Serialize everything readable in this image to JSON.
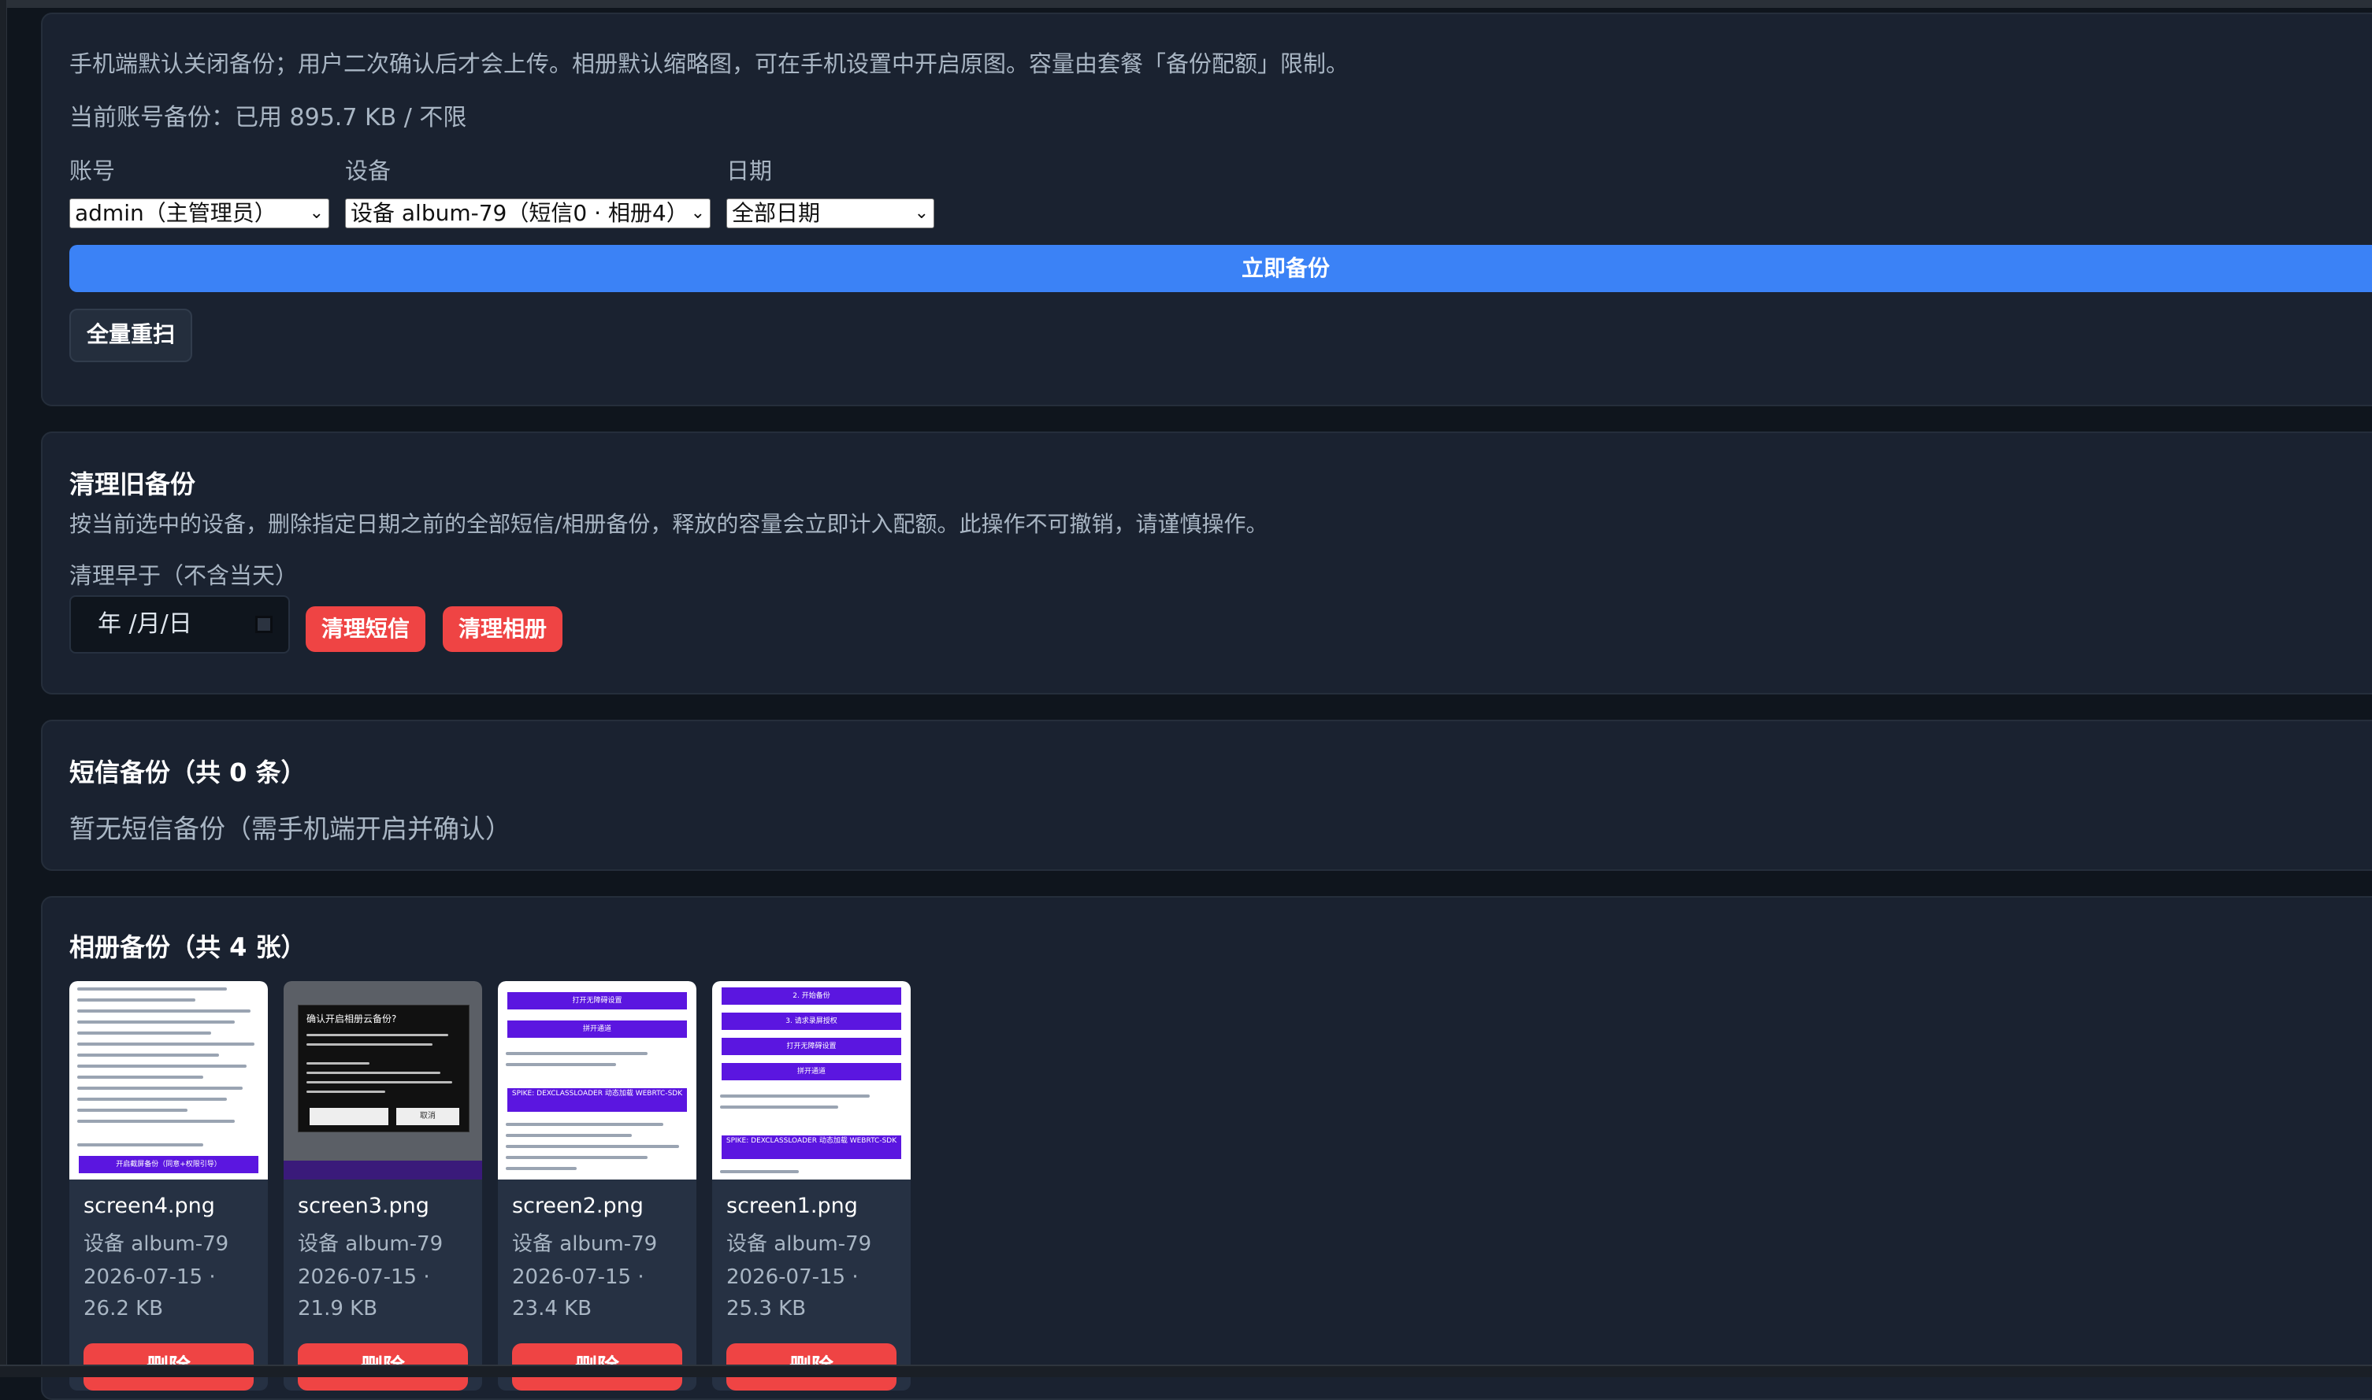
{
  "backup_settings": {
    "notice": "手机端默认关闭备份；用户二次确认后才会上传。相册默认缩略图，可在手机设置中开启原图。容量由套餐「备份配额」限制。",
    "usage": "当前账号备份：已用 895.7 KB / 不限",
    "account_label": "账号",
    "account_value": "admin（主管理员）",
    "device_label": "设备",
    "device_value": "设备 album-79（短信0 · 相册4）",
    "date_label": "日期",
    "date_value": "全部日期",
    "backup_now": "立即备份",
    "full_rescan": "全量重扫"
  },
  "cleanup": {
    "title": "清理旧备份",
    "description": "按当前选中的设备，删除指定日期之前的全部短信/相册备份，释放的容量会立即计入配额。此操作不可撤销，请谨慎操作。",
    "before_label": "清理早于（不含当天）",
    "date_placeholder": "年 /月/日",
    "clear_sms": "清理短信",
    "clear_album": "清理相册"
  },
  "sms": {
    "title": "短信备份（共 0 条）",
    "empty": "暂无短信备份（需手机端开启并确认）"
  },
  "album": {
    "title": "相册备份（共 4 张）",
    "items": [
      {
        "name": "screen4.png",
        "device": "设备 album-79",
        "info": "2026-07-15 · 26.2 KB",
        "delete": "删除",
        "thumb_caption": "开启截屏备份（同意+权限引导）"
      },
      {
        "name": "screen3.png",
        "device": "设备 album-79",
        "info": "2026-07-15 · 21.9 KB",
        "delete": "删除",
        "thumb_dialog_title": "确认开启相册云备份?",
        "thumb_cancel": "取消"
      },
      {
        "name": "screen2.png",
        "device": "设备 album-79",
        "info": "2026-07-15 · 23.4 KB",
        "delete": "删除",
        "thumb_btn1": "打开无障碍设置",
        "thumb_btn2": "拼开通道",
        "thumb_spike": "SPIKE: DEXCLASSLOADER 动态加载 WEBRTC-SDK"
      },
      {
        "name": "screen1.png",
        "device": "设备 album-79",
        "info": "2026-07-15 · 25.3 KB",
        "delete": "删除",
        "thumb_btn1": "2. 开始备份",
        "thumb_btn2": "3. 请求录屏授权",
        "thumb_btn3": "打开无障碍设置",
        "thumb_btn4": "拼开通道",
        "thumb_spike": "SPIKE: DEXCLASSLOADER 动态加载 WEBRTC-SDK"
      }
    ]
  },
  "colors": {
    "primary": "#3b82f6",
    "danger": "#ef4444",
    "card_bg": "#1a2230",
    "page_bg": "#0f151d"
  }
}
